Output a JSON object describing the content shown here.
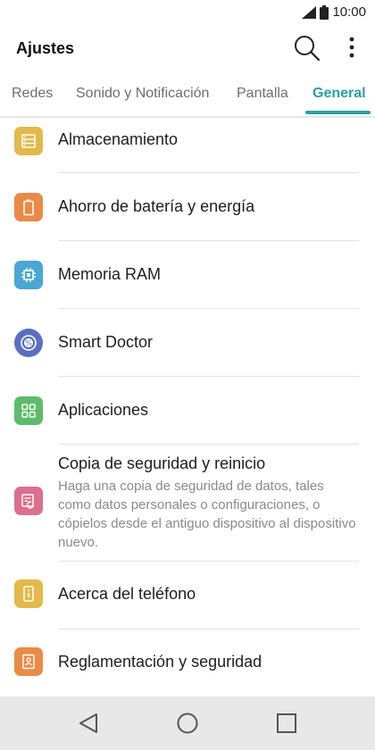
{
  "status": {
    "time": "10:00"
  },
  "header": {
    "title": "Ajustes"
  },
  "tabs": [
    {
      "label": "Redes"
    },
    {
      "label": "Sonido y Notificación"
    },
    {
      "label": "Pantalla"
    },
    {
      "label": "General"
    }
  ],
  "active_tab": "General",
  "items": [
    {
      "title": "Almacenamiento",
      "icon": "storage-icon",
      "color": "#e2b94a"
    },
    {
      "title": "Ahorro de batería y energía",
      "icon": "battery-icon",
      "color": "#ea8a45"
    },
    {
      "title": "Memoria RAM",
      "icon": "memory-chip-icon",
      "color": "#4aa6d3"
    },
    {
      "title": "Smart Doctor",
      "icon": "smart-doctor-icon",
      "color": "#5a6fc4"
    },
    {
      "title": "Aplicaciones",
      "icon": "apps-grid-icon",
      "color": "#5fbb6c"
    },
    {
      "title": "Copia de seguridad y reinicio",
      "subtitle": "Haga una copia de seguridad de datos, tales como datos personales o configuraciones, o cópielos desde el antiguo dispositivo al dispositivo nuevo.",
      "icon": "backup-restore-icon",
      "color": "#dc6f8e"
    },
    {
      "title": "Acerca del teléfono",
      "icon": "about-phone-icon",
      "color": "#e2b94a"
    },
    {
      "title": "Reglamentación y seguridad",
      "icon": "regulatory-icon",
      "color": "#ea8a45"
    }
  ],
  "nav": {
    "back_icon": "back-triangle-icon",
    "home_icon": "home-circle-icon",
    "recents_icon": "recents-square-icon"
  }
}
